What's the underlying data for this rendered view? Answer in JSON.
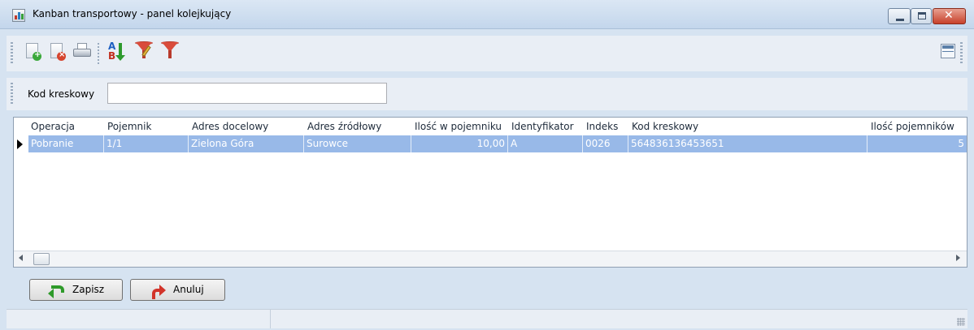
{
  "window": {
    "title": "Kanban transportowy - panel kolejkujący",
    "controls": [
      "minimize",
      "maximize",
      "close"
    ],
    "close_glyph": "✕"
  },
  "toolbar": {
    "icons": [
      "new-document-icon",
      "delete-document-icon",
      "print-icon",
      "sort-az-icon",
      "filter-edit-icon",
      "filter-icon",
      "layout-icon"
    ]
  },
  "filter": {
    "label": "Kod kreskowy",
    "value": ""
  },
  "grid": {
    "columns": [
      "Operacja",
      "Pojemnik",
      "Adres docelowy",
      "Adres źródłowy",
      "Ilość w pojemniku",
      "Identyfikator",
      "Indeks",
      "Kod kreskowy",
      "Ilość pojemników"
    ],
    "rows": [
      {
        "operacja": "Pobranie",
        "pojemnik": "1/1",
        "adres_docelowy": "Zielona Góra",
        "adres_zrodlowy": "Surowce",
        "ilosc_w_pojemniku": "10,00",
        "identyfikator": "A",
        "indeks": "0026",
        "kod_kreskowy": "564836136453651",
        "ilosc_pojemnikow": "5"
      }
    ],
    "selected_row": 0,
    "selection_color": "#98b9e8"
  },
  "buttons": {
    "save_label": "Zapisz",
    "cancel_label": "Anuluj"
  },
  "status": {
    "left": "",
    "right": ""
  }
}
